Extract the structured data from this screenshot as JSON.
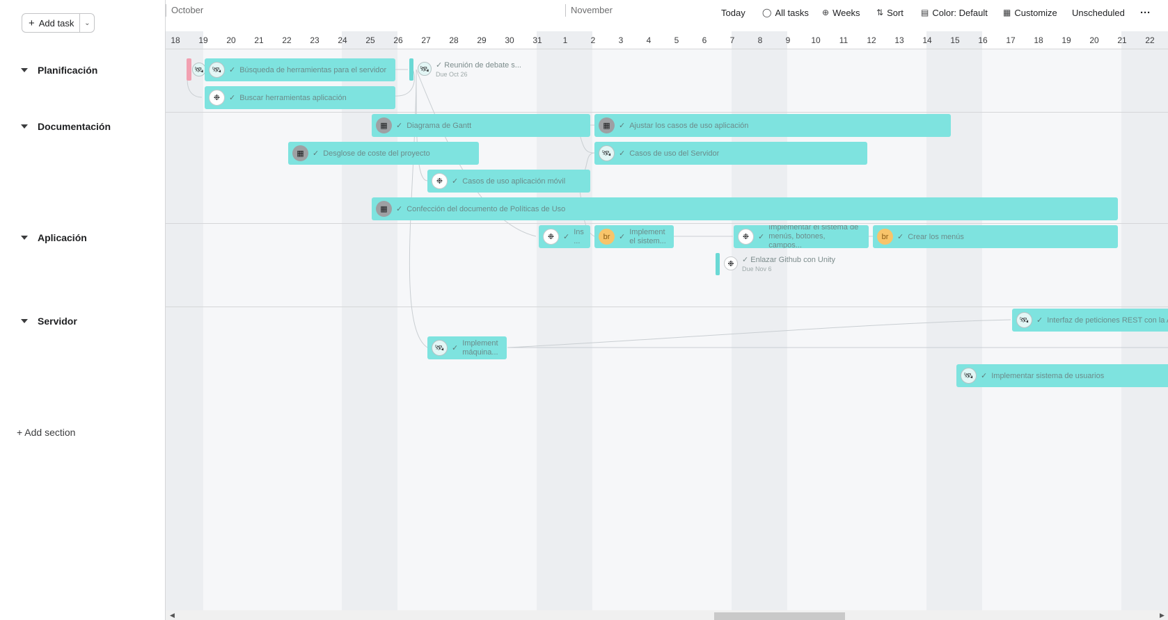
{
  "left": {
    "add_task": "Add task",
    "sections": [
      "Planificación",
      "Documentación",
      "Aplicación",
      "Servidor"
    ],
    "add_section": "+ Add section"
  },
  "header": {
    "months": [
      "October",
      "November"
    ],
    "days": [
      "18",
      "19",
      "20",
      "21",
      "22",
      "23",
      "24",
      "25",
      "26",
      "27",
      "28",
      "29",
      "30",
      "31",
      "1",
      "2",
      "3",
      "4",
      "5",
      "6",
      "7",
      "8",
      "9",
      "10",
      "11",
      "12",
      "13",
      "14",
      "15",
      "16",
      "17",
      "18",
      "19",
      "20",
      "21",
      "22"
    ]
  },
  "toolbar": {
    "today": "Today",
    "all_tasks": "All tasks",
    "weeks": "Weeks",
    "sort": "Sort",
    "color": "Color: Default",
    "customize": "Customize",
    "unscheduled": "Unscheduled",
    "more": "···"
  },
  "tasks": {
    "busqueda": "Búsqueda de herramientas para el servidor",
    "buscar": "Buscar herramientas aplicación",
    "reunion": "Reunión de debate s...",
    "reunion_due": "Due Oct 26",
    "gantt": "Diagrama de Gantt",
    "ajustar": "Ajustar los casos de uso aplicación",
    "desglose": "Desglose de coste del proyecto",
    "casos_servidor": "Casos de uso del Servidor",
    "casos_movil": "Casos de uso aplicación móvil",
    "politicas": "Confección del documento de Políticas de Uso",
    "ins": "Ins ...",
    "implement_sistem": "Implement el sistem...",
    "implementar_menus": "Implementar el sistema de menús, botones, campos...",
    "crear_menus": "Crear los menús",
    "github": "Enlazar Github con Unity",
    "github_due": "Due Nov 6",
    "interfaz": "Interfaz de peticiones REST con la A",
    "implement_maquina": "Implement máquina...",
    "usuarios": "Implementar sistema de usuarios"
  },
  "avatars": {
    "br": "br"
  },
  "colors": {
    "bar": "#7ee3df",
    "milestone_red": "#f2a0b1",
    "milestone": "#6bd9d5"
  }
}
